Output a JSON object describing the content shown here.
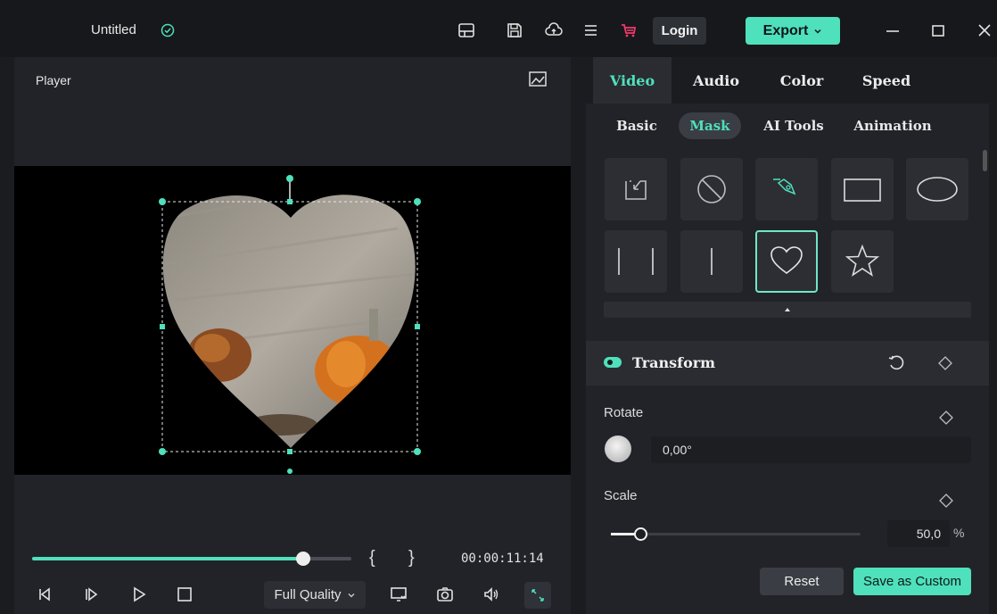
{
  "titlebar": {
    "project_title": "Untitled",
    "login_label": "Login",
    "export_label": "Export",
    "accent": "#4fe0bc",
    "cart_color": "#f03a6b"
  },
  "player": {
    "label": "Player",
    "timecode": "00:00:11:14",
    "mark_in": "{",
    "mark_out": "}",
    "quality_label": "Full Quality",
    "progress": 0.85
  },
  "panel": {
    "tabs": [
      {
        "label": "Video",
        "active": true
      },
      {
        "label": "Audio",
        "active": false
      },
      {
        "label": "Color",
        "active": false
      },
      {
        "label": "Speed",
        "active": false
      }
    ],
    "subtabs": [
      {
        "label": "Basic",
        "active": false
      },
      {
        "label": "Mask",
        "active": true
      },
      {
        "label": "AI Tools",
        "active": false
      },
      {
        "label": "Animation",
        "active": false
      }
    ],
    "masks": [
      {
        "name": "import-mask-icon"
      },
      {
        "name": "no-mask-icon"
      },
      {
        "name": "pen-mask-icon"
      },
      {
        "name": "rectangle-mask-icon"
      },
      {
        "name": "ellipse-mask-icon"
      },
      {
        "name": "double-line-mask-icon"
      },
      {
        "name": "single-line-mask-icon"
      },
      {
        "name": "heart-mask-icon",
        "selected": true
      },
      {
        "name": "star-mask-icon"
      }
    ],
    "transform": {
      "title": "Transform",
      "rotate_label": "Rotate",
      "rotate_value": "0,00°",
      "scale_label": "Scale",
      "scale_value": "50,0",
      "scale_unit": "%",
      "scale_level": 0.5
    },
    "reset_label": "Reset",
    "save_custom_label": "Save as Custom"
  }
}
